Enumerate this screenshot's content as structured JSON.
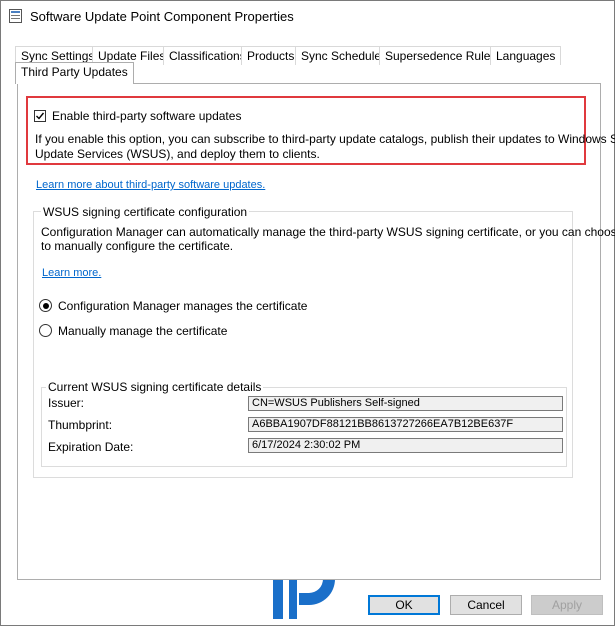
{
  "window": {
    "title": "Software Update Point Component Properties"
  },
  "tabs": {
    "row1": [
      "Sync Settings",
      "Update Files",
      "Classifications",
      "Products",
      "Sync Schedule",
      "Supersedence Rules",
      "Languages"
    ],
    "active": "Third Party Updates"
  },
  "third_party": {
    "enable_label": "Enable third-party software updates",
    "enable_checked": true,
    "description_line1": "If you enable this option, you can subscribe to third-party update catalogs, publish their updates to Windows Server",
    "description_line2": "Update Services (WSUS), and deploy them to clients.",
    "learn_more_link": "Learn more about third-party software updates."
  },
  "cert_config": {
    "group_title": "WSUS signing certificate configuration",
    "description_line1": "Configuration Manager can automatically manage the third-party WSUS signing certificate, or you can choose",
    "description_line2": "to manually configure the certificate.",
    "learn_more_link": "Learn more.",
    "option_auto": "Configuration Manager manages the certificate",
    "option_manual": "Manually manage the certificate",
    "selected": "auto"
  },
  "cert_details": {
    "group_title": "Current WSUS signing certificate details",
    "issuer_label": "Issuer:",
    "issuer_value": "CN=WSUS Publishers Self-signed",
    "thumbprint_label": "Thumbprint:",
    "thumbprint_value": "A6BBA1907DF88121BB8613727266EA7B12BE637F",
    "expiration_label": "Expiration Date:",
    "expiration_value": "6/17/2024 2:30:02 PM"
  },
  "buttons": {
    "ok": "OK",
    "cancel": "Cancel",
    "apply": "Apply"
  },
  "colors": {
    "highlight": "#e0393e",
    "link": "#0066cc",
    "logo_blue": "#1a6fc9",
    "default_button_border": "#0078d7"
  },
  "icons": {
    "app": "app-icon",
    "check": "check-icon",
    "logo": "brand-logo-icon"
  }
}
